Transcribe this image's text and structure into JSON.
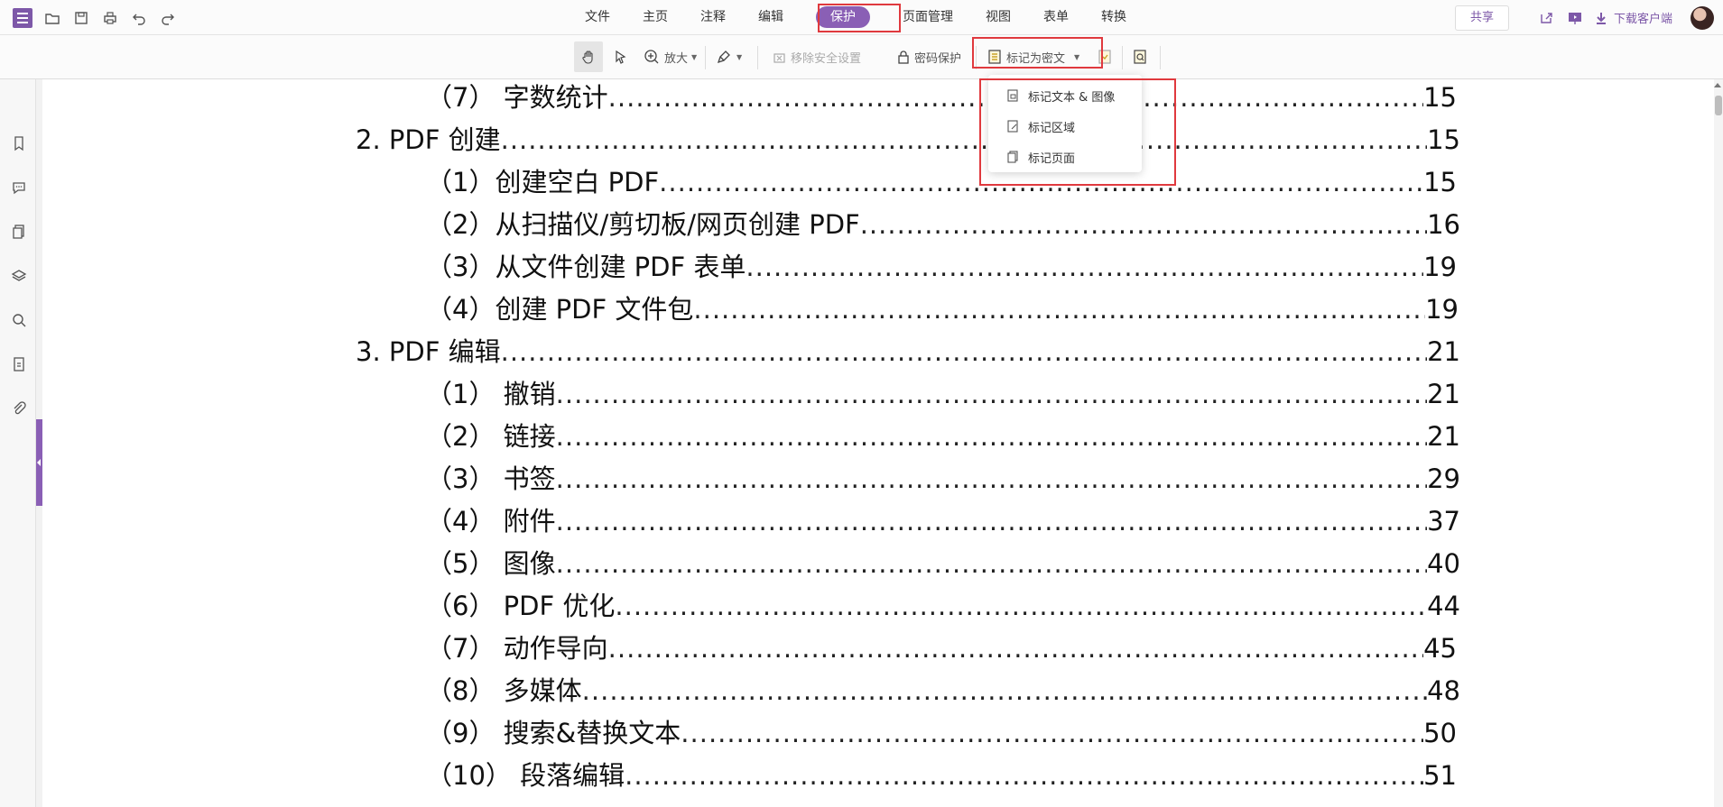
{
  "menu": {
    "tabs": [
      "文件",
      "主页",
      "注释",
      "编辑",
      "保护",
      "页面管理",
      "视图",
      "表单",
      "转换"
    ],
    "active_tab": "保护",
    "share_label": "共享",
    "download_label": "下载客户端"
  },
  "toolbar": {
    "zoom_label": "放大",
    "remove_security_label": "移除安全设置",
    "password_protect_label": "密码保护",
    "mark_redact_label": "标记为密文"
  },
  "dropdown": {
    "items": [
      "标记文本 & 图像",
      "标记区域",
      "标记页面"
    ]
  },
  "toc": [
    {
      "label": "（7）  字数统计",
      "page": "15"
    },
    {
      "label": "2.  PDF 创建",
      "page": "15"
    },
    {
      "label": "（1）创建空白 PDF",
      "page": "15"
    },
    {
      "label": "（2）从扫描仪/剪切板/网页创建 PDF",
      "page": " 16"
    },
    {
      "label": "（3）从文件创建 PDF 表单",
      "page": "19"
    },
    {
      "label": "（4）创建 PDF 文件包",
      "page": "19"
    },
    {
      "label": "3.  PDF 编辑",
      "page": "21"
    },
    {
      "label": "（1）  撤销",
      "page": "21"
    },
    {
      "label": "（2）  链接",
      "page": "21"
    },
    {
      "label": "（3）  书签",
      "page": "29"
    },
    {
      "label": "（4）  附件",
      "page": "37"
    },
    {
      "label": "（5）  图像",
      "page": "40"
    },
    {
      "label": "（6）  PDF 优化",
      "page": "44"
    },
    {
      "label": "（7）  动作导向",
      "page": "45"
    },
    {
      "label": "（8）  多媒体",
      "page": "48"
    },
    {
      "label": "（9）  搜索&替换文本",
      "page": "50"
    },
    {
      "label": "（10）  段落编辑",
      "page": "51"
    }
  ],
  "colors": {
    "accent": "#8a5fb5",
    "highlight": "#e0393e"
  }
}
